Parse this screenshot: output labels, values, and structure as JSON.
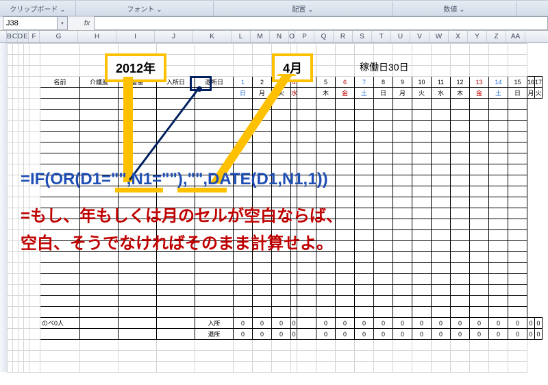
{
  "ribbon": {
    "g1": "クリップボード",
    "g1_arrow": "⌄",
    "g2": "フォント",
    "g2_arrow": "⌄",
    "g3": "配置",
    "g3_arrow": "⌄",
    "g4": "数値",
    "g4_arrow": "⌄"
  },
  "namebox": "J38",
  "fx_label": "fx",
  "columns": [
    "B",
    "C",
    "D",
    "E",
    "F",
    "G",
    "H",
    "I",
    "J",
    "K",
    "L",
    "M",
    "N",
    "O",
    "P",
    "Q",
    "R",
    "S",
    "T",
    "U",
    "V",
    "W",
    "X",
    "Y",
    "Z",
    "AA"
  ],
  "callouts": {
    "year": "2012年",
    "month": "4月",
    "workdays": "稼働日30日"
  },
  "table": {
    "hdr": {
      "name": "名前",
      "care": "介護度",
      "sou": "層重",
      "in": "入所日",
      "outday": "退所日"
    },
    "days": [
      "1",
      "2",
      "3",
      "4",
      "",
      "5",
      "6",
      "7",
      "8",
      "9",
      "10",
      "11",
      "12",
      "13",
      "14",
      "15",
      "16",
      "17"
    ],
    "wk": [
      "日",
      "月",
      "火",
      "水",
      "",
      "木",
      "金",
      "土",
      "日",
      "月",
      "火",
      "水",
      "木",
      "金",
      "土",
      "日",
      "月",
      "火"
    ],
    "blue_idx": [
      0,
      7,
      14
    ],
    "red_idx": [
      3,
      6,
      13
    ]
  },
  "footer": {
    "label": "のべ0人",
    "row1": "入所",
    "row2": "退所",
    "zero": "0"
  },
  "annotations": {
    "formula": "=IF(OR(D1=\"\",N1=\"\"),\"\",DATE(D1,N1,1))",
    "jp1": "=もし、年もしくは月のセルが空白ならば、",
    "jp2": "空白、そうでなければそのまま計算せよ。"
  }
}
